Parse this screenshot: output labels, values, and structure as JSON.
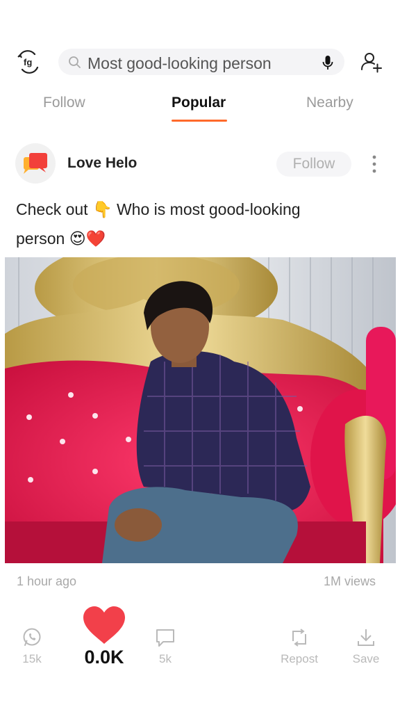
{
  "header": {
    "search_query": "Most good-looking person",
    "logo_icon": "helo-logo-icon",
    "mic_icon": "microphone-icon",
    "add_user_icon": "add-user-icon"
  },
  "tabs": [
    {
      "label": "Follow",
      "active": false
    },
    {
      "label": "Popular",
      "active": true
    },
    {
      "label": "Nearby",
      "active": false
    }
  ],
  "post": {
    "author": "Love Helo",
    "follow_label": "Follow",
    "caption_line1": "Check out 👇 Who is most good-looking",
    "caption_line2": "person 😍❤️",
    "time": "1 hour ago",
    "views": "1M views"
  },
  "actions": {
    "share_count": "15k",
    "like_count": "0.0K",
    "comment_count": "5k",
    "repost_label": "Repost",
    "save_label": "Save"
  },
  "colors": {
    "accent": "#ff6a2b",
    "like_red": "#f2404a",
    "sofa_red": "#e81e4a",
    "gold": "#d9bd6a"
  }
}
